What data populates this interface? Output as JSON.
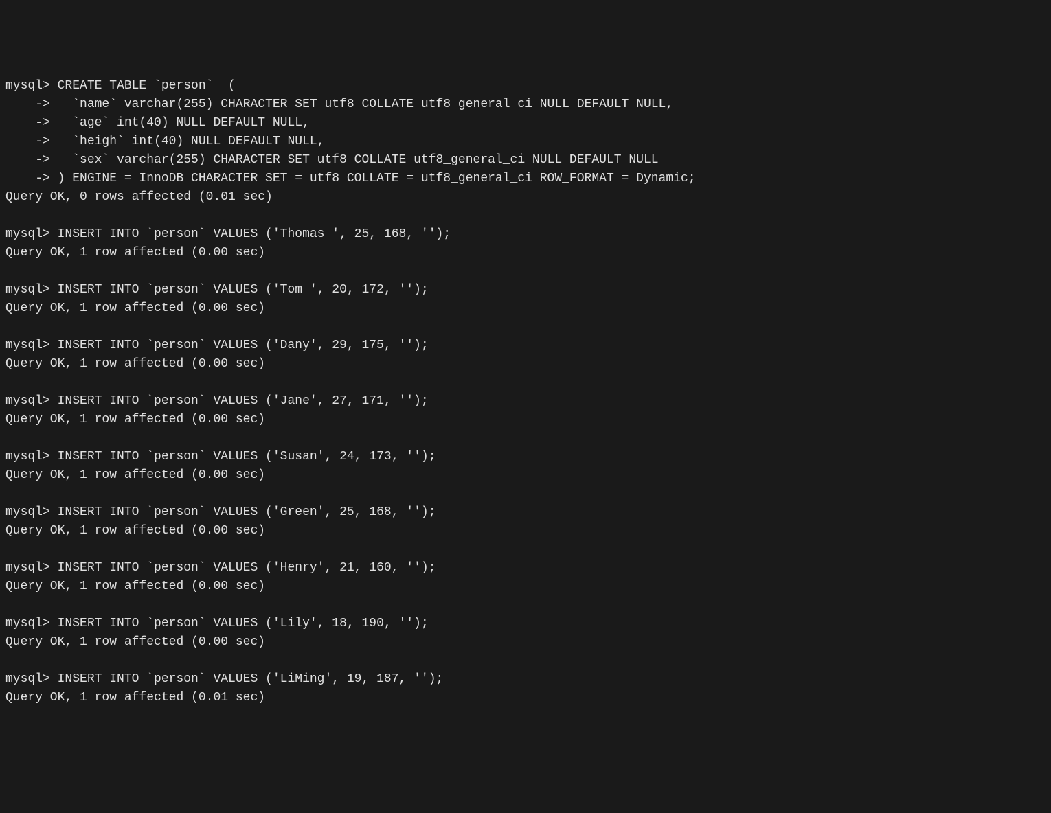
{
  "lines": [
    "mysql> CREATE TABLE `person`  (",
    "    ->   `name` varchar(255) CHARACTER SET utf8 COLLATE utf8_general_ci NULL DEFAULT NULL,",
    "    ->   `age` int(40) NULL DEFAULT NULL,",
    "    ->   `heigh` int(40) NULL DEFAULT NULL,",
    "    ->   `sex` varchar(255) CHARACTER SET utf8 COLLATE utf8_general_ci NULL DEFAULT NULL",
    "    -> ) ENGINE = InnoDB CHARACTER SET = utf8 COLLATE = utf8_general_ci ROW_FORMAT = Dynamic;",
    "Query OK, 0 rows affected (0.01 sec)",
    "",
    "mysql> INSERT INTO `person` VALUES ('Thomas ', 25, 168, '');",
    "Query OK, 1 row affected (0.00 sec)",
    "",
    "mysql> INSERT INTO `person` VALUES ('Tom ', 20, 172, '');",
    "Query OK, 1 row affected (0.00 sec)",
    "",
    "mysql> INSERT INTO `person` VALUES ('Dany', 29, 175, '');",
    "Query OK, 1 row affected (0.00 sec)",
    "",
    "mysql> INSERT INTO `person` VALUES ('Jane', 27, 171, '');",
    "Query OK, 1 row affected (0.00 sec)",
    "",
    "mysql> INSERT INTO `person` VALUES ('Susan', 24, 173, '');",
    "Query OK, 1 row affected (0.00 sec)",
    "",
    "mysql> INSERT INTO `person` VALUES ('Green', 25, 168, '');",
    "Query OK, 1 row affected (0.00 sec)",
    "",
    "mysql> INSERT INTO `person` VALUES ('Henry', 21, 160, '');",
    "Query OK, 1 row affected (0.00 sec)",
    "",
    "mysql> INSERT INTO `person` VALUES ('Lily', 18, 190, '');",
    "Query OK, 1 row affected (0.00 sec)",
    "",
    "mysql> INSERT INTO `person` VALUES ('LiMing', 19, 187, '');",
    "Query OK, 1 row affected (0.01 sec)"
  ]
}
